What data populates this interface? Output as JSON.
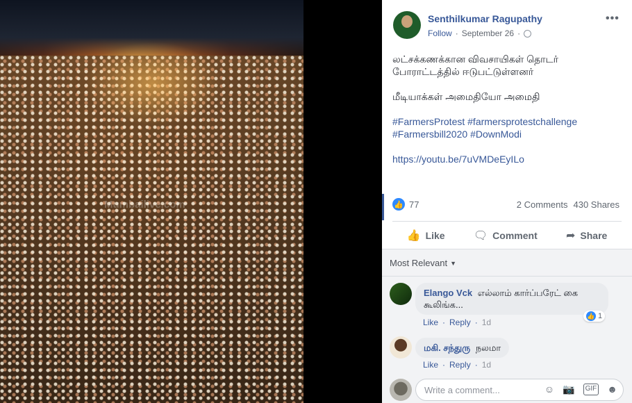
{
  "post": {
    "author": "Senthilkumar Ragupathy",
    "follow_label": "Follow",
    "date": "September 26",
    "paragraph1_line1": "லட்சக்கணக்கான விவசாயிகள் தொடர்",
    "paragraph1_line2": "போராட்டத்தில் ஈடுபட்டுள்ளனர்",
    "paragraph2": "மீடியாக்கள் அமைதியோ அமைதி",
    "hashtags_line1": [
      "#FarmersProtest",
      "#farmersprotestchallenge"
    ],
    "hashtags_line2": [
      "#Farmersbill2020",
      "#DownModi"
    ],
    "link": "https://youtu.be/7uVMDeEyILo",
    "like_count": "77",
    "comments_count": "2 Comments",
    "shares_count": "430 Shares"
  },
  "photo": {
    "watermark": "Mumbailive.com"
  },
  "actions": {
    "like": "Like",
    "comment": "Comment",
    "share": "Share"
  },
  "comments_header": "Most Relevant",
  "comments": [
    {
      "name": "Elango Vck",
      "text_line1": "எல்லாம் கார்ப்பரேட் கை",
      "text_line2": "கூலிங்க...",
      "like": "Like",
      "reply": "Reply",
      "time": "1d",
      "reaction_count": "1"
    },
    {
      "name": "மகி. சந்துரு",
      "text_line1": "நலமா",
      "like": "Like",
      "reply": "Reply",
      "time": "1d"
    }
  ],
  "composer": {
    "placeholder": "Write a comment..."
  },
  "colors": {
    "link": "#385898",
    "like_blue": "#2e89ff"
  },
  "icons": {
    "globe": "globe-icon",
    "more": "more-options-icon",
    "like": "thumbs-up-icon",
    "comment": "speech-bubble-icon",
    "share": "share-arrow-icon",
    "emoji": "emoji-icon",
    "camera": "camera-icon",
    "gif": "gif-icon",
    "sticker": "sticker-icon"
  }
}
